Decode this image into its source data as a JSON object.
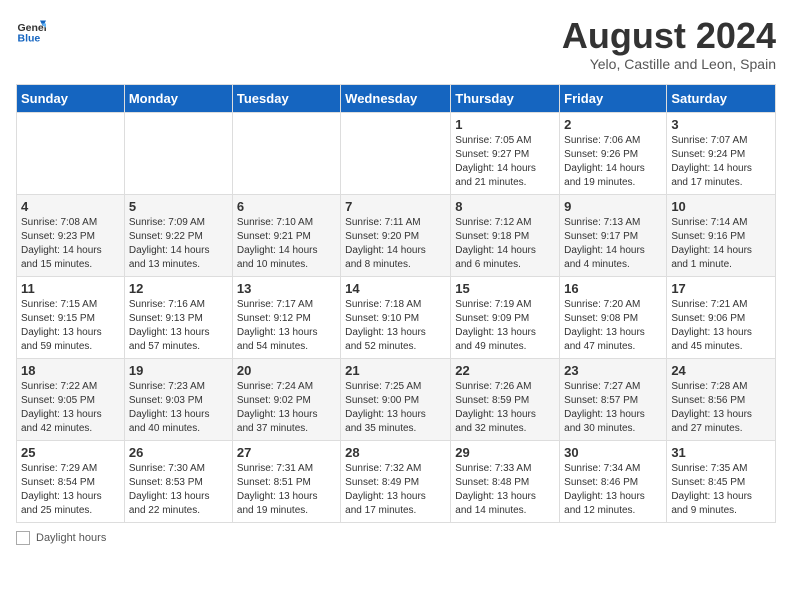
{
  "header": {
    "logo_line1": "General",
    "logo_line2": "Blue",
    "month_year": "August 2024",
    "location": "Yelo, Castille and Leon, Spain"
  },
  "weekdays": [
    "Sunday",
    "Monday",
    "Tuesday",
    "Wednesday",
    "Thursday",
    "Friday",
    "Saturday"
  ],
  "weeks": [
    [
      {
        "day": "",
        "info": ""
      },
      {
        "day": "",
        "info": ""
      },
      {
        "day": "",
        "info": ""
      },
      {
        "day": "",
        "info": ""
      },
      {
        "day": "1",
        "info": "Sunrise: 7:05 AM\nSunset: 9:27 PM\nDaylight: 14 hours\nand 21 minutes."
      },
      {
        "day": "2",
        "info": "Sunrise: 7:06 AM\nSunset: 9:26 PM\nDaylight: 14 hours\nand 19 minutes."
      },
      {
        "day": "3",
        "info": "Sunrise: 7:07 AM\nSunset: 9:24 PM\nDaylight: 14 hours\nand 17 minutes."
      }
    ],
    [
      {
        "day": "4",
        "info": "Sunrise: 7:08 AM\nSunset: 9:23 PM\nDaylight: 14 hours\nand 15 minutes."
      },
      {
        "day": "5",
        "info": "Sunrise: 7:09 AM\nSunset: 9:22 PM\nDaylight: 14 hours\nand 13 minutes."
      },
      {
        "day": "6",
        "info": "Sunrise: 7:10 AM\nSunset: 9:21 PM\nDaylight: 14 hours\nand 10 minutes."
      },
      {
        "day": "7",
        "info": "Sunrise: 7:11 AM\nSunset: 9:20 PM\nDaylight: 14 hours\nand 8 minutes."
      },
      {
        "day": "8",
        "info": "Sunrise: 7:12 AM\nSunset: 9:18 PM\nDaylight: 14 hours\nand 6 minutes."
      },
      {
        "day": "9",
        "info": "Sunrise: 7:13 AM\nSunset: 9:17 PM\nDaylight: 14 hours\nand 4 minutes."
      },
      {
        "day": "10",
        "info": "Sunrise: 7:14 AM\nSunset: 9:16 PM\nDaylight: 14 hours\nand 1 minute."
      }
    ],
    [
      {
        "day": "11",
        "info": "Sunrise: 7:15 AM\nSunset: 9:15 PM\nDaylight: 13 hours\nand 59 minutes."
      },
      {
        "day": "12",
        "info": "Sunrise: 7:16 AM\nSunset: 9:13 PM\nDaylight: 13 hours\nand 57 minutes."
      },
      {
        "day": "13",
        "info": "Sunrise: 7:17 AM\nSunset: 9:12 PM\nDaylight: 13 hours\nand 54 minutes."
      },
      {
        "day": "14",
        "info": "Sunrise: 7:18 AM\nSunset: 9:10 PM\nDaylight: 13 hours\nand 52 minutes."
      },
      {
        "day": "15",
        "info": "Sunrise: 7:19 AM\nSunset: 9:09 PM\nDaylight: 13 hours\nand 49 minutes."
      },
      {
        "day": "16",
        "info": "Sunrise: 7:20 AM\nSunset: 9:08 PM\nDaylight: 13 hours\nand 47 minutes."
      },
      {
        "day": "17",
        "info": "Sunrise: 7:21 AM\nSunset: 9:06 PM\nDaylight: 13 hours\nand 45 minutes."
      }
    ],
    [
      {
        "day": "18",
        "info": "Sunrise: 7:22 AM\nSunset: 9:05 PM\nDaylight: 13 hours\nand 42 minutes."
      },
      {
        "day": "19",
        "info": "Sunrise: 7:23 AM\nSunset: 9:03 PM\nDaylight: 13 hours\nand 40 minutes."
      },
      {
        "day": "20",
        "info": "Sunrise: 7:24 AM\nSunset: 9:02 PM\nDaylight: 13 hours\nand 37 minutes."
      },
      {
        "day": "21",
        "info": "Sunrise: 7:25 AM\nSunset: 9:00 PM\nDaylight: 13 hours\nand 35 minutes."
      },
      {
        "day": "22",
        "info": "Sunrise: 7:26 AM\nSunset: 8:59 PM\nDaylight: 13 hours\nand 32 minutes."
      },
      {
        "day": "23",
        "info": "Sunrise: 7:27 AM\nSunset: 8:57 PM\nDaylight: 13 hours\nand 30 minutes."
      },
      {
        "day": "24",
        "info": "Sunrise: 7:28 AM\nSunset: 8:56 PM\nDaylight: 13 hours\nand 27 minutes."
      }
    ],
    [
      {
        "day": "25",
        "info": "Sunrise: 7:29 AM\nSunset: 8:54 PM\nDaylight: 13 hours\nand 25 minutes."
      },
      {
        "day": "26",
        "info": "Sunrise: 7:30 AM\nSunset: 8:53 PM\nDaylight: 13 hours\nand 22 minutes."
      },
      {
        "day": "27",
        "info": "Sunrise: 7:31 AM\nSunset: 8:51 PM\nDaylight: 13 hours\nand 19 minutes."
      },
      {
        "day": "28",
        "info": "Sunrise: 7:32 AM\nSunset: 8:49 PM\nDaylight: 13 hours\nand 17 minutes."
      },
      {
        "day": "29",
        "info": "Sunrise: 7:33 AM\nSunset: 8:48 PM\nDaylight: 13 hours\nand 14 minutes."
      },
      {
        "day": "30",
        "info": "Sunrise: 7:34 AM\nSunset: 8:46 PM\nDaylight: 13 hours\nand 12 minutes."
      },
      {
        "day": "31",
        "info": "Sunrise: 7:35 AM\nSunset: 8:45 PM\nDaylight: 13 hours\nand 9 minutes."
      }
    ]
  ],
  "footer": {
    "legend_label": "Daylight hours"
  }
}
